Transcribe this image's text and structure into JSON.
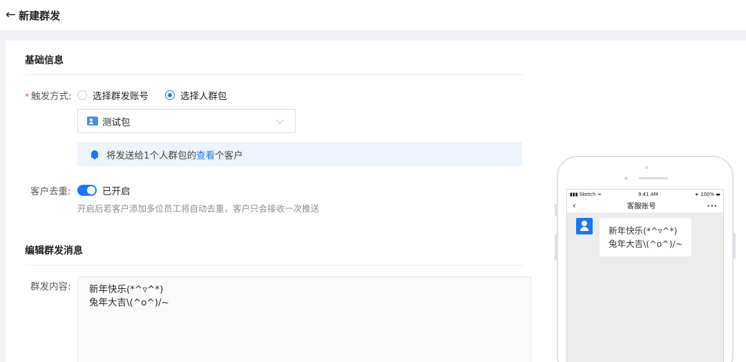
{
  "header": {
    "back_icon": "←",
    "title": "新建群发"
  },
  "basic": {
    "section_title": "基础信息",
    "trigger_label": "触发方式:",
    "radio_options": [
      {
        "label": "选择群发账号",
        "checked": false
      },
      {
        "label": "选择人群包",
        "checked": true
      }
    ],
    "select_value": "测试包",
    "notice": {
      "prefix": "将发送给1个人群包的",
      "link": "查看",
      "suffix": "个客户"
    },
    "dedup_label": "客户去重:",
    "dedup_status": "已开启",
    "dedup_enabled": true,
    "dedup_hint": "开启后若客户添加多位员工将自动去重，客户只会接收一次推送"
  },
  "message": {
    "section_title": "编辑群发消息",
    "content_label": "群发内容:",
    "content_lines": [
      "新年快乐(*^▿^*)",
      "兔年大吉\\(^o^)/~"
    ]
  },
  "phone": {
    "status_left": "Sketch",
    "status_time": "9:41 AM",
    "status_battery": "100%",
    "nav_title": "客服账号",
    "bubble_lines": [
      "新年快乐(*^▿^*)",
      "兔年大吉\\(^o^)/~"
    ]
  },
  "colors": {
    "accent": "#1677ff",
    "required": "#ff4d4f",
    "notice_bg": "#eef4fd"
  }
}
